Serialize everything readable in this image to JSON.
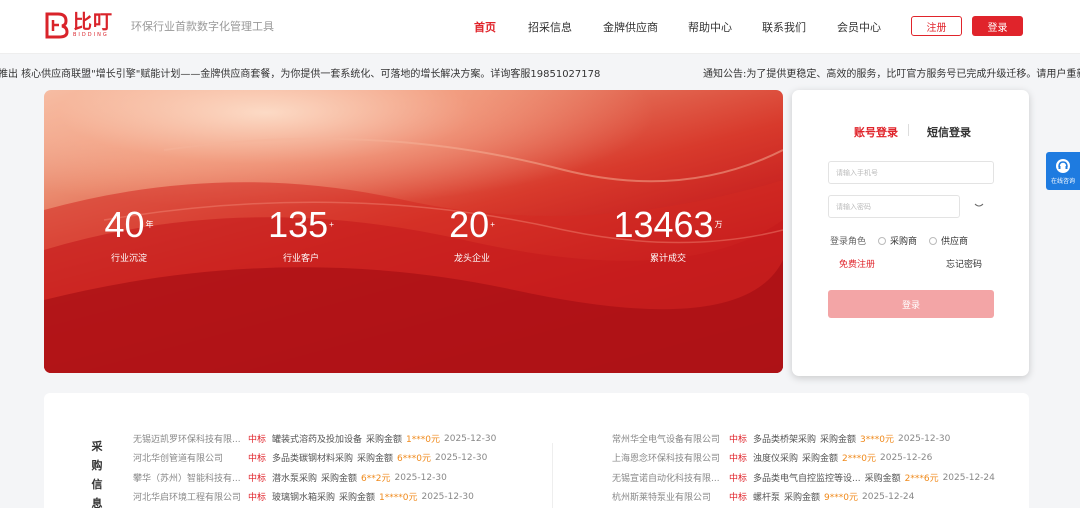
{
  "header": {
    "logo_name": "比叮",
    "logo_sub": "BIDDING",
    "slogan": "环保行业首款数字化管理工具",
    "nav": [
      "首页",
      "招采信息",
      "金牌供应商",
      "帮助中心",
      "联系我们",
      "会员中心"
    ],
    "register_label": "注册",
    "login_label": "登录"
  },
  "marquee": {
    "text_a": "推出 核心供应商联盟\"增长引擎\"赋能计划——金牌供应商套餐，为你提供一套系统化、可落地的增长解决方案。详询客服19851027178",
    "text_b": "通知公告:为了提供更稳定、高效的服务，比叮官方服务号已完成升级迁移。请用户重新关注比"
  },
  "banner": {
    "stats": [
      {
        "num": "40",
        "unit": "年",
        "label": "行业沉淀"
      },
      {
        "num": "135",
        "unit": "+",
        "label": "行业客户"
      },
      {
        "num": "20",
        "unit": "+",
        "label": "龙头企业"
      },
      {
        "num": "13463",
        "unit": "万",
        "label": "累计成交"
      }
    ]
  },
  "login": {
    "tab_account": "账号登录",
    "tab_sms": "短信登录",
    "phone_placeholder": "请输入手机号",
    "password_placeholder": "请输入密码",
    "role_label": "登录角色",
    "role_buyer": "采购商",
    "role_supplier": "供应商",
    "free_register": "免费注册",
    "forgot": "忘记密码",
    "submit": "登录"
  },
  "side": {
    "service_label": "在线咨询"
  },
  "list": {
    "title": "采购信息",
    "left": [
      {
        "company": "无锡迈凯罗环保科技有限...",
        "tag": "中标",
        "item": "罐装式溶药及投加设备",
        "amount_label": "采购金额",
        "amount": "1***0元",
        "date": "2025-12-30"
      },
      {
        "company": "河北华创管道有限公司",
        "tag": "中标",
        "item": "多品类碳钢材料采购",
        "amount_label": "采购金额",
        "amount": "6***0元",
        "date": "2025-12-30"
      },
      {
        "company": "攀华（苏州）智能科技有...",
        "tag": "中标",
        "item": "潜水泵采购",
        "amount_label": "采购金额",
        "amount": "6**2元",
        "date": "2025-12-30"
      },
      {
        "company": "河北华启环境工程有限公司",
        "tag": "中标",
        "item": "玻璃钢水箱采购",
        "amount_label": "采购金额",
        "amount": "1****0元",
        "date": "2025-12-30"
      }
    ],
    "right": [
      {
        "company": "常州华全电气设备有限公司",
        "tag": "中标",
        "item": "多品类桥架采购",
        "amount_label": "采购金额",
        "amount": "3***0元",
        "date": "2025-12-30"
      },
      {
        "company": "上海恩念环保科技有限公司",
        "tag": "中标",
        "item": "浊度仪采购",
        "amount_label": "采购金额",
        "amount": "2***0元",
        "date": "2025-12-26"
      },
      {
        "company": "无锡宣诺自动化科技有限...",
        "tag": "中标",
        "item": "多品类电气自控监控等设...",
        "amount_label": "采购金额",
        "amount": "2***6元",
        "date": "2025-12-24"
      },
      {
        "company": "杭州斯莱特泵业有限公司",
        "tag": "中标",
        "item": "螺杆泵",
        "amount_label": "采购金额",
        "amount": "9***0元",
        "date": "2025-12-24"
      }
    ]
  }
}
